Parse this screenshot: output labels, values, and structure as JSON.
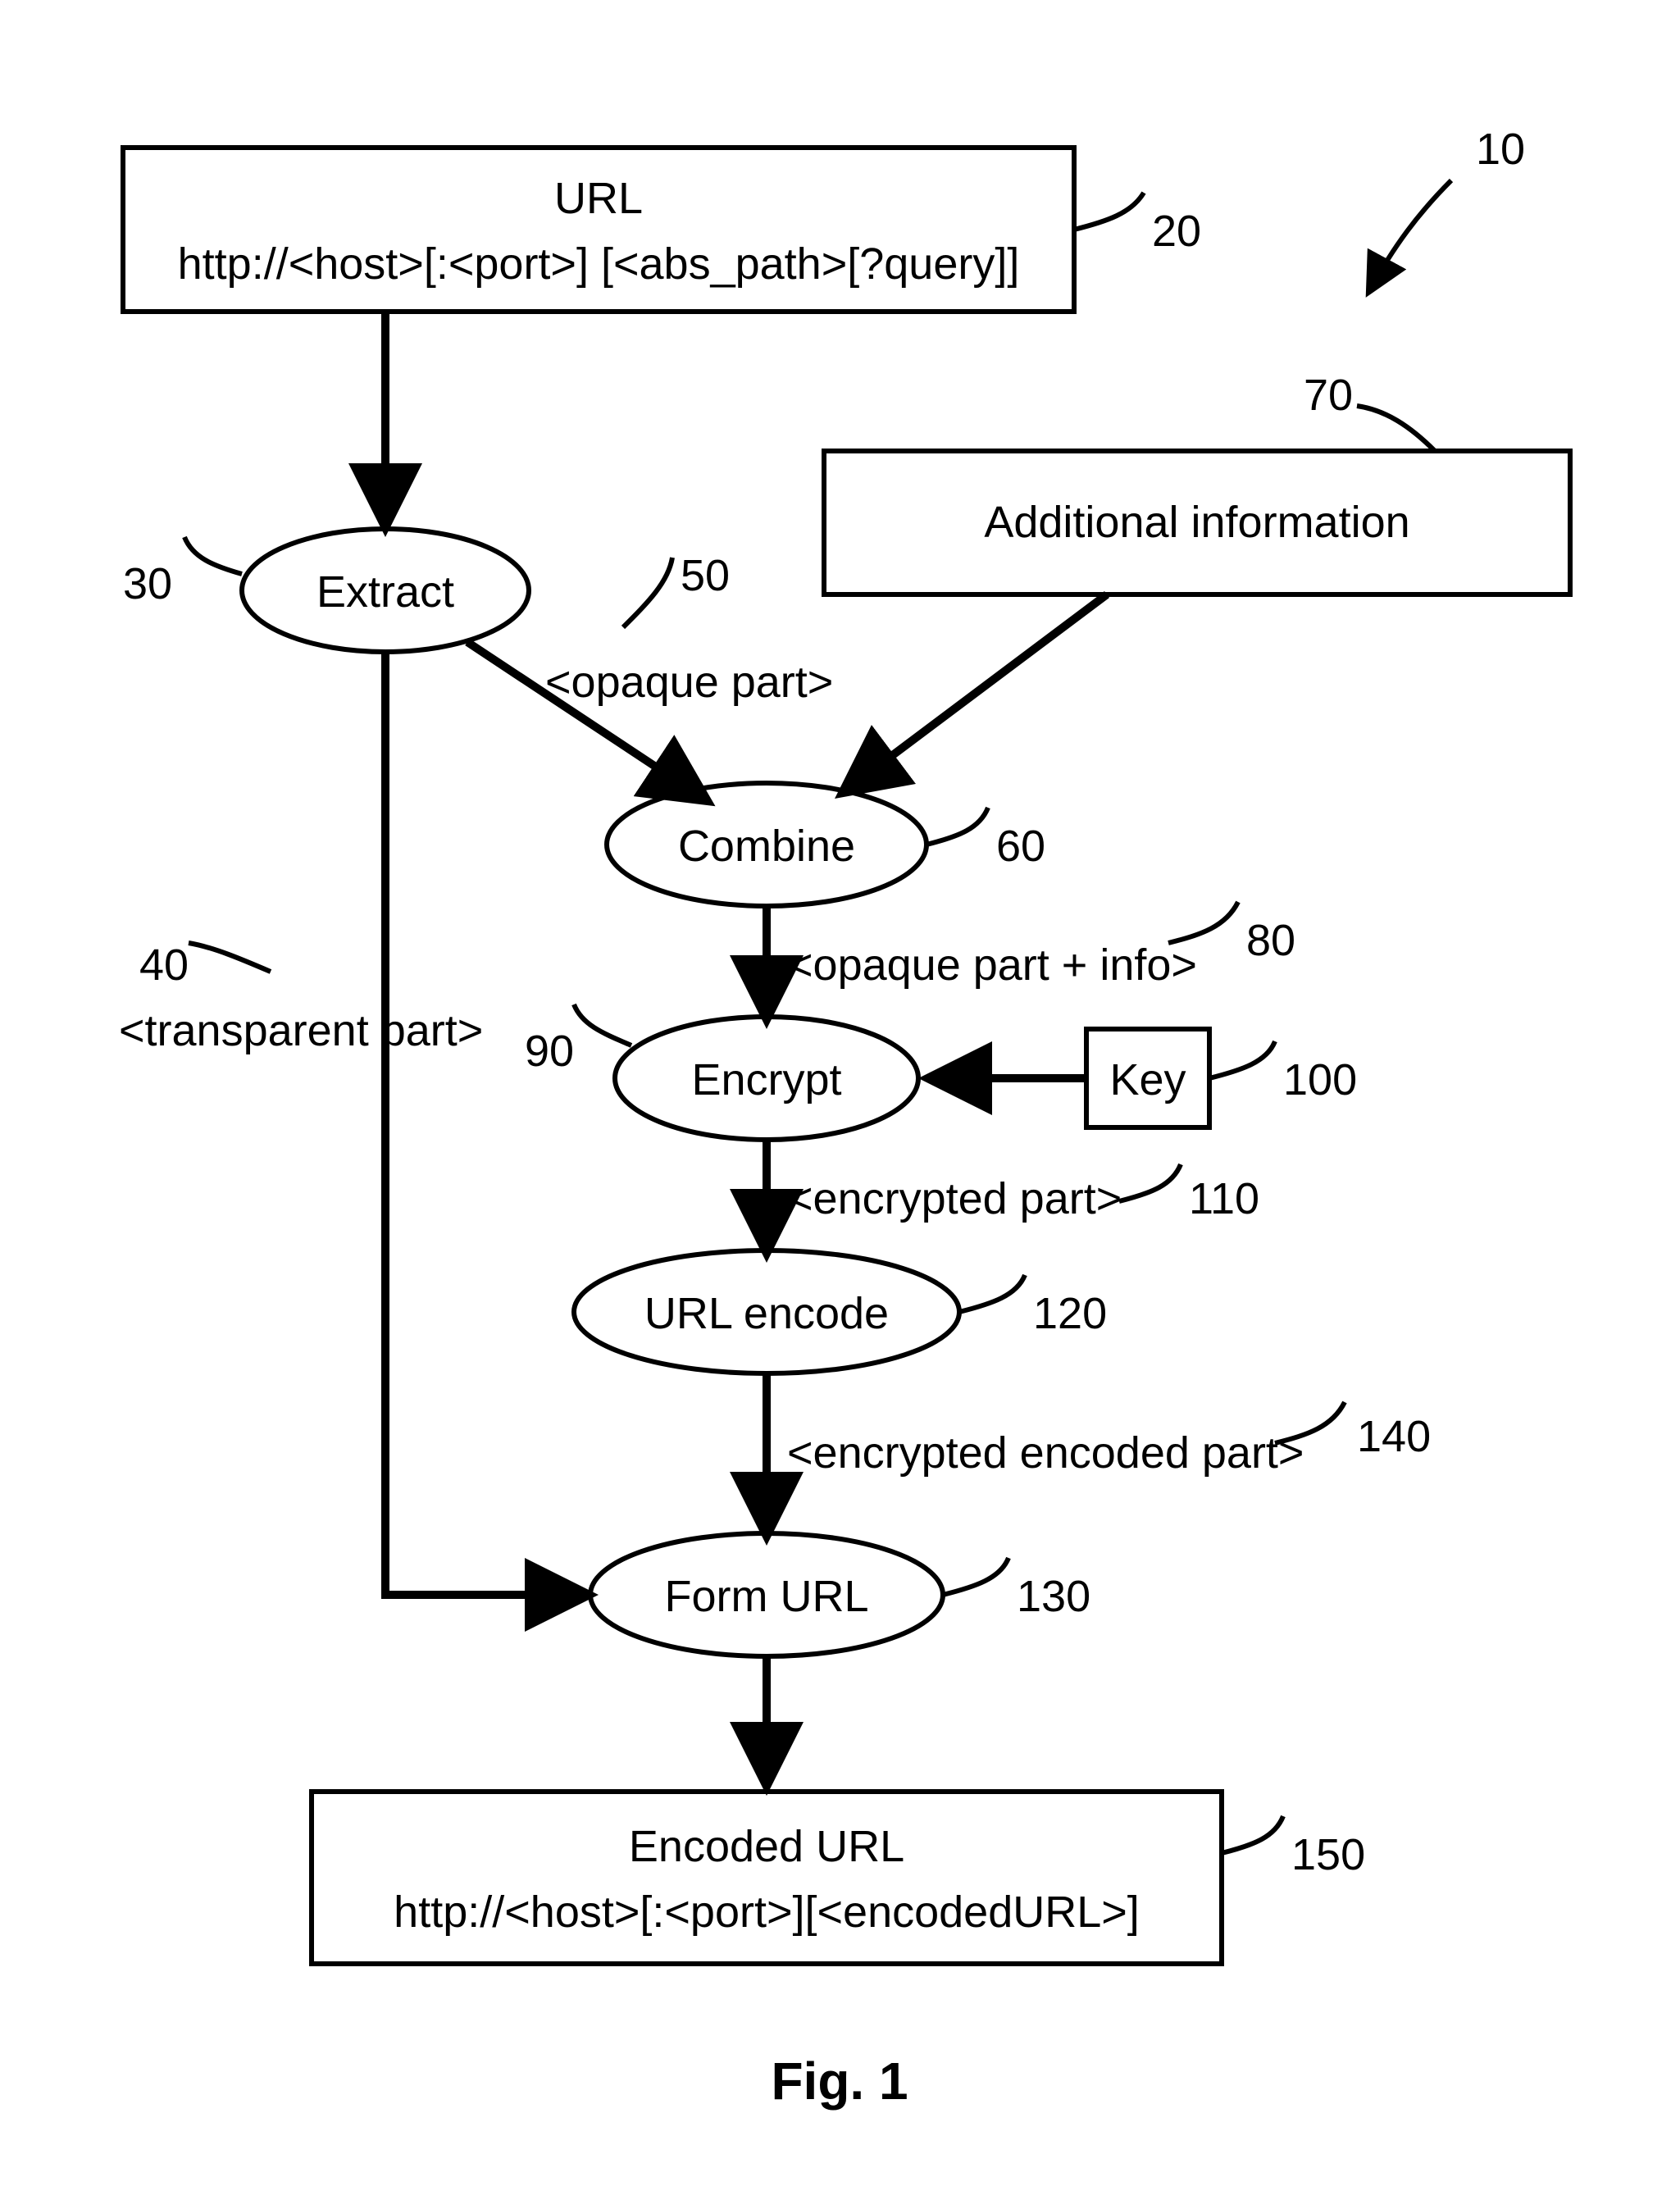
{
  "figure_caption": "Fig. 1",
  "refs": {
    "r10": "10",
    "r20": "20",
    "r30": "30",
    "r40": "40",
    "r50": "50",
    "r60": "60",
    "r70": "70",
    "r80": "80",
    "r90": "90",
    "r100": "100",
    "r110": "110",
    "r120": "120",
    "r130": "130",
    "r140": "140",
    "r150": "150"
  },
  "nodes": {
    "url_box_title": "URL",
    "url_box_body": "http://<host>[:<port>] [<abs_path>[?query]]",
    "extract": "Extract",
    "additional_info": "Additional information",
    "combine": "Combine",
    "encrypt": "Encrypt",
    "key": "Key",
    "url_encode": "URL encode",
    "form_url": "Form URL",
    "encoded_url_title": "Encoded URL",
    "encoded_url_body": "http://<host>[:<port>][<encodedURL>]"
  },
  "edge_labels": {
    "opaque_part": "<opaque part>",
    "transparent_part": "<transparent part>",
    "opaque_plus_info": "<opaque part + info>",
    "encrypted_part": "<encrypted part>",
    "encrypted_encoded_part": "<encrypted encoded part>"
  }
}
